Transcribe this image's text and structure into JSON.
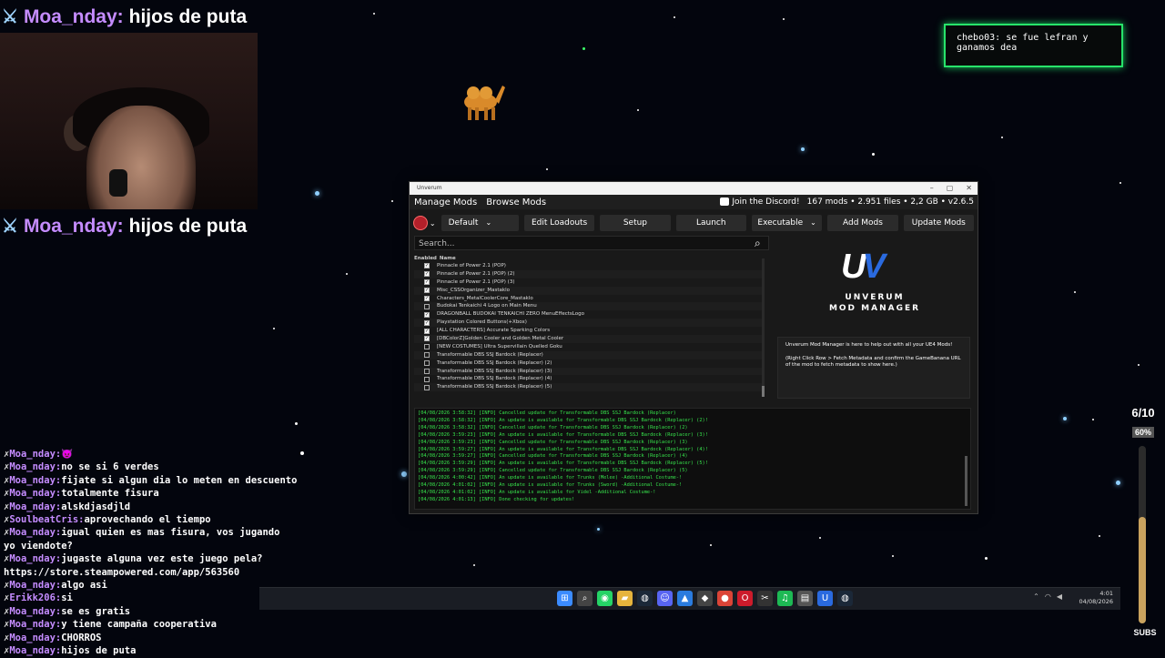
{
  "overlay": {
    "top_banner": {
      "name": "Moa_nday:",
      "message": "hijos de puta"
    },
    "mid_banner": {
      "name": "Moa_nday:",
      "message": "hijos de puta"
    },
    "notification": {
      "user": "chebo03:",
      "text": "se fue lefran y ganamos dea"
    },
    "goal": {
      "count": "6/10",
      "percent_label": "60%",
      "fraction": 0.6,
      "label": "SUBS"
    }
  },
  "chat": [
    {
      "user": "Moa_nday:",
      "text": "😈"
    },
    {
      "user": "Moa_nday:",
      "text": "no se si 6 verdes"
    },
    {
      "user": "Moa_nday:",
      "text": "fijate si algun dia lo meten en descuento"
    },
    {
      "user": "Moa_nday:",
      "text": "totalmente fisura"
    },
    {
      "user": "Moa_nday:",
      "text": "alskdjasdjld"
    },
    {
      "user": "SoulbeatCris:",
      "text": "aprovechando el tiempo"
    },
    {
      "user": "Moa_nday:",
      "text": "igual quien es mas fisura, vos jugando"
    },
    {
      "user": "",
      "text": "yo viendote?"
    },
    {
      "user": "Moa_nday:",
      "text": "jugaste alguna vez este juego pela?"
    },
    {
      "user": "",
      "text": "https://store.steampowered.com/app/563560"
    },
    {
      "user": "Moa_nday:",
      "text": "algo asi"
    },
    {
      "user": "Erikk206:",
      "text": "si"
    },
    {
      "user": "Moa_nday:",
      "text": "se es gratis"
    },
    {
      "user": "Moa_nday:",
      "text": "y tiene campaña cooperativa"
    },
    {
      "user": "Moa_nday:",
      "text": "CHORROS"
    },
    {
      "user": "Moa_nday:",
      "text": "hijos de puta"
    }
  ],
  "window": {
    "title": "Unverum",
    "tabs": [
      "Manage Mods",
      "Browse Mods"
    ],
    "discord": "Join the Discord!",
    "stats": "167 mods • 2.951 files • 2,2 GB • v2.6.5",
    "toolbar": {
      "loadout": "Default",
      "edit_loadouts": "Edit Loadouts",
      "setup": "Setup",
      "launch": "Launch",
      "executable": "Executable",
      "add_mods": "Add Mods",
      "update_mods": "Update Mods"
    },
    "search_placeholder": "Search...",
    "columns": {
      "enabled": "Enabled",
      "name": "Name"
    },
    "mods": [
      {
        "name": "Pinnacle of Power 2.1 (POP)",
        "enabled": true
      },
      {
        "name": "Pinnacle of Power 2.1 (POP) (2)",
        "enabled": true
      },
      {
        "name": "Pinnacle of Power 2.1 (POP) (3)",
        "enabled": true
      },
      {
        "name": "Misc_CSSOrganizer_Mastaklo",
        "enabled": true
      },
      {
        "name": "Characters_MetalCoolerCore_Mastaklo",
        "enabled": true
      },
      {
        "name": "Budokai Tenkaichi 4 Logo on Main Menu",
        "enabled": false
      },
      {
        "name": "DRAGONBALL BUDOKAI TENKAICHI ZERO MenuEffectsLogo",
        "enabled": true
      },
      {
        "name": "Playstation Colored Buttons(+Xbox)",
        "enabled": true
      },
      {
        "name": "[ALL CHARACTERS] Accurate  Sparking Colors",
        "enabled": true
      },
      {
        "name": "[DBColorZ]Golden Cooler and Golden Metal Cooler",
        "enabled": true
      },
      {
        "name": "[NEW COSTUMES] Ultra Supervillain Quelled Goku",
        "enabled": false
      },
      {
        "name": "Transformable DBS SSJ Bardock (Replacer)",
        "enabled": false
      },
      {
        "name": "Transformable DBS SSJ Bardock (Replacer) (2)",
        "enabled": false
      },
      {
        "name": "Transformable DBS SSJ Bardock (Replacer) (3)",
        "enabled": false
      },
      {
        "name": "Transformable DBS SSJ Bardock (Replacer) (4)",
        "enabled": false
      },
      {
        "name": "Transformable DBS SSJ Bardock (Replacer) (5)",
        "enabled": false
      }
    ],
    "logo": {
      "line1": "UNVERUM",
      "line2": "MOD MANAGER"
    },
    "info": [
      "Unverum Mod Manager is here to help out with all your UE4 Mods!",
      "(Right Click Row > Fetch Metadata and confirm the GameBanana URL of the mod to fetch metadata to show here.)"
    ],
    "console": [
      "[04/08/2026 3:58:32] [INFO] Cancelled update for Transformable DBS SSJ Bardock (Replacer)",
      "[04/08/2026 3:58:32] [INFO] An update is available for Transformable DBS SSJ Bardock (Replacer) (2)!",
      "[04/08/2026 3:58:32] [INFO] Cancelled update for Transformable DBS SSJ Bardock (Replacer) (2)",
      "[04/08/2026 3:59:23] [INFO] An update is available for Transformable DBS SSJ Bardock (Replacer) (3)!",
      "[04/08/2026 3:59:23] [INFO] Cancelled update for Transformable DBS SSJ Bardock (Replacer) (3)",
      "[04/08/2026 3:59:27] [INFO] An update is available for Transformable DBS SSJ Bardock (Replacer) (4)!",
      "[04/08/2026 3:59:27] [INFO] Cancelled update for Transformable DBS SSJ Bardock (Replacer) (4)",
      "[04/08/2026 3:59:29] [INFO] An update is available for Transformable DBS SSJ Bardock (Replacer) (5)!",
      "[04/08/2026 3:59:29] [INFO] Cancelled update for Transformable DBS SSJ Bardock (Replacer) (5)",
      "[04/08/2026 4:00:42] [INFO] An update is available for Trunks (Melee) -Additional Costume-!",
      "[04/08/2026 4:01:02] [INFO] An update is available for Trunks (Sword) -Additional Costume-!",
      "[04/08/2026 4:01:02] [INFO] An update is available for Videl -Additional Costume-!",
      "[04/08/2026 4:01:13] [INFO] Done checking for updates!"
    ]
  },
  "taskbar": {
    "time": "4:01",
    "date": "04/08/2026",
    "apps": [
      "start-icon",
      "search-icon",
      "whatsapp-icon",
      "folder-icon",
      "steam-icon",
      "discord-icon",
      "store-icon",
      "app-icon",
      "chrome-icon",
      "opera-icon",
      "capcut-icon",
      "spotify-icon",
      "media-icon",
      "unverum-icon",
      "steam2-icon"
    ]
  },
  "colors": {
    "accent": "#2a6adf",
    "console": "#37e34c",
    "chat_user": "#c58cff",
    "notif_border": "#27e46a"
  }
}
